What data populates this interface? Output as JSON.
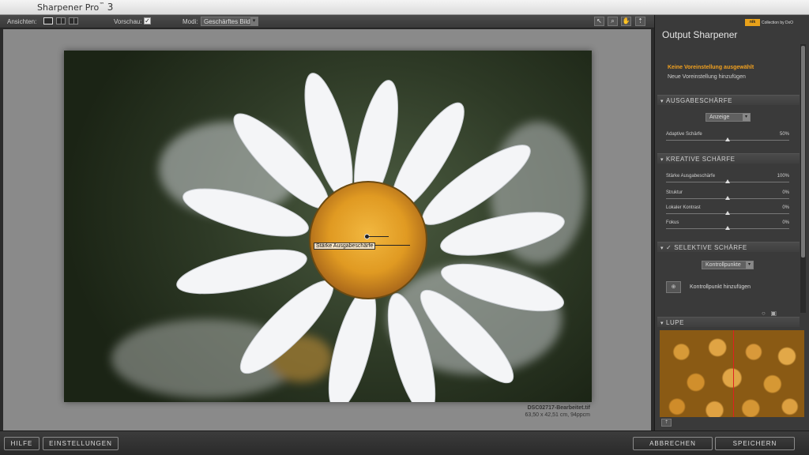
{
  "app": {
    "title_name": "Sharpener Pro",
    "title_tm": "™",
    "title_version": "3"
  },
  "toolbar": {
    "views_label": "Ansichten:",
    "preview_label": "Vorschau:",
    "preview_checked": true,
    "mode_label": "Modi:",
    "mode_value": "Geschärftes Bild",
    "tools": [
      "hand-pointer-icon",
      "zoom-icon",
      "hand-pan-icon",
      "pin-icon"
    ]
  },
  "canvas": {
    "control_point_label": "Stärke Ausgabeschärfe",
    "file_name": "DSC02717-Bearbeitet.tif",
    "file_info": "63,50 x 42,51 cm, 94ppcm"
  },
  "panel": {
    "brand": "Collection by DxO",
    "brand_logo": "nik",
    "title": "Output Sharpener",
    "preset_state": "Keine Voreinstellung ausgewählt",
    "preset_add": "Neue Voreinstellung hinzufügen",
    "section_output": "AUSGABESCHÄRFE",
    "output_dropdown": "Anzeige",
    "adaptive_label": "Adaptive Schärfe",
    "adaptive_value": "50%",
    "adaptive_fraction": 0.5,
    "section_creative": "KREATIVE SCHÄRFE",
    "creative_sliders": [
      {
        "label": "Stärke Ausgabeschärfe",
        "value": "100%",
        "fraction": 0.5
      },
      {
        "label": "Struktur",
        "value": "0%",
        "fraction": 0.5
      },
      {
        "label": "Lokaler Kontrast",
        "value": "0%",
        "fraction": 0.5
      },
      {
        "label": "Fokus",
        "value": "0%",
        "fraction": 0.5
      }
    ],
    "section_selective": "SELEKTIVE SCHÄRFE",
    "selective_checked": true,
    "selective_dropdown": "Kontrollpunkte",
    "add_control_point": "Kontrollpunkt hinzufügen",
    "section_loupe": "LUPE"
  },
  "bottom": {
    "help": "HILFE",
    "settings": "EINSTELLUNGEN",
    "cancel": "ABBRECHEN",
    "save": "SPEICHERN"
  }
}
